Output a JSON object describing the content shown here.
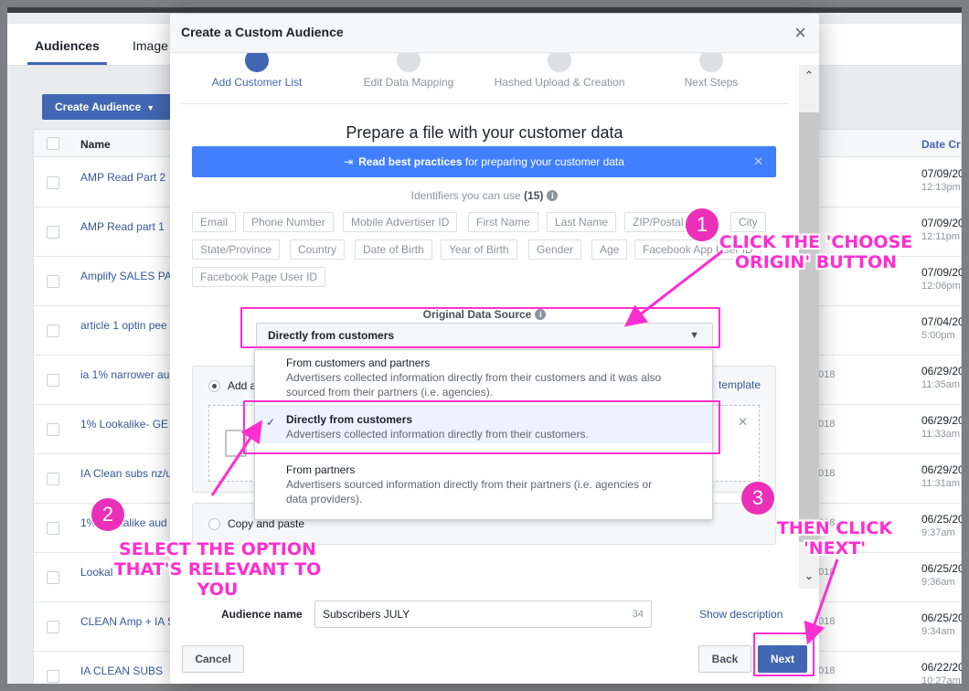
{
  "background": {
    "tabs": [
      "Audiences",
      "Image"
    ],
    "create_button": "Create Audience",
    "columns": {
      "name": "Name",
      "date": "Date Cr"
    },
    "rows": [
      {
        "name": "AMP Read Part 2",
        "date": "07/09/20",
        "time": "12:13pm",
        "mid": "ıl"
      },
      {
        "name": "AMP Read part 1",
        "date": "07/09/20",
        "time": "12:11pm",
        "mid": "ıl"
      },
      {
        "name": "Amplify SALES PA",
        "date": "07/09/20",
        "time": "12:06pm",
        "mid": "ıl"
      },
      {
        "name": "article 1 optin pee",
        "date": "07/04/20",
        "time": "5:00pm",
        "mid": ""
      },
      {
        "name": "ia 1% narrower au",
        "date": "06/29/20",
        "time": "11:35am",
        "mid": "/2018"
      },
      {
        "name": "1% Lookalike- GE",
        "date": "06/29/20",
        "time": "11:33am",
        "mid": "/2018"
      },
      {
        "name": "IA Clean subs nz/u",
        "date": "06/29/20",
        "time": "11:31am",
        "mid": "/2018"
      },
      {
        "name": "1% Lookalike aud",
        "date": "06/25/20",
        "time": "9:37am",
        "mid": "/2018"
      },
      {
        "name": "Lookal",
        "date": "06/25/20",
        "time": "9:36am",
        "mid": "/2018"
      },
      {
        "name": "CLEAN Amp + IA S",
        "date": "06/25/20",
        "time": "9:34am",
        "mid": "/2018"
      },
      {
        "name": "IA CLEAN SUBS",
        "date": "06/22/20",
        "time": "10:27am",
        "mid": "/2018"
      }
    ]
  },
  "modal": {
    "title": "Create a Custom Audience",
    "close": "×",
    "steps": [
      "Add Customer List",
      "Edit Data Mapping",
      "Hashed Upload & Creation",
      "Next Steps"
    ],
    "prepare_title": "Prepare a file with your customer data",
    "best_practices": {
      "bold": "Read best practices",
      "rest": " for preparing your customer data"
    },
    "identifiers_label": "Identifiers you can use",
    "identifiers_count": "(15)",
    "identifiers": [
      "Email",
      "Phone Number",
      "Mobile Advertiser ID",
      "First Name",
      "Last Name",
      "ZIP/Postal",
      "City",
      "State/Province",
      "Country",
      "Date of Birth",
      "Year of Birth",
      "Gender",
      "Age",
      "Facebook App User ID",
      "Facebook Page User ID"
    ],
    "original_data_source_label": "Original Data Source",
    "original_data_source_value": "Directly from customers",
    "add_label": "Add a",
    "template_link": "template",
    "copy_paste": "Copy and paste",
    "dropdown_options": [
      {
        "title": "From customers and partners",
        "desc": "Advertisers collected information directly from their customers and it was also sourced from their partners (i.e. agencies).",
        "selected": false
      },
      {
        "title": "Directly from customers",
        "desc": "Advertisers collected information directly from their customers.",
        "selected": true
      },
      {
        "title": "From partners",
        "desc": "Advertisers sourced information directly from their partners (i.e. agencies or data providers).",
        "selected": false
      }
    ],
    "audience_name_label": "Audience name",
    "audience_name_value": "Subscribers JULY",
    "audience_name_count": "34",
    "show_description": "Show description",
    "cancel": "Cancel",
    "back": "Back",
    "next": "Next"
  },
  "annotations": {
    "badge1": "1",
    "badge2": "2",
    "badge3": "3",
    "note1": "CLICK THE 'CHOOSE\nORIGIN' BUTTON",
    "note2": "SELECT THE OPTION\nTHAT'S RELEVANT TO\nYOU",
    "note3": "THEN CLICK\n'NEXT'",
    "color": "#ff2ed1"
  }
}
